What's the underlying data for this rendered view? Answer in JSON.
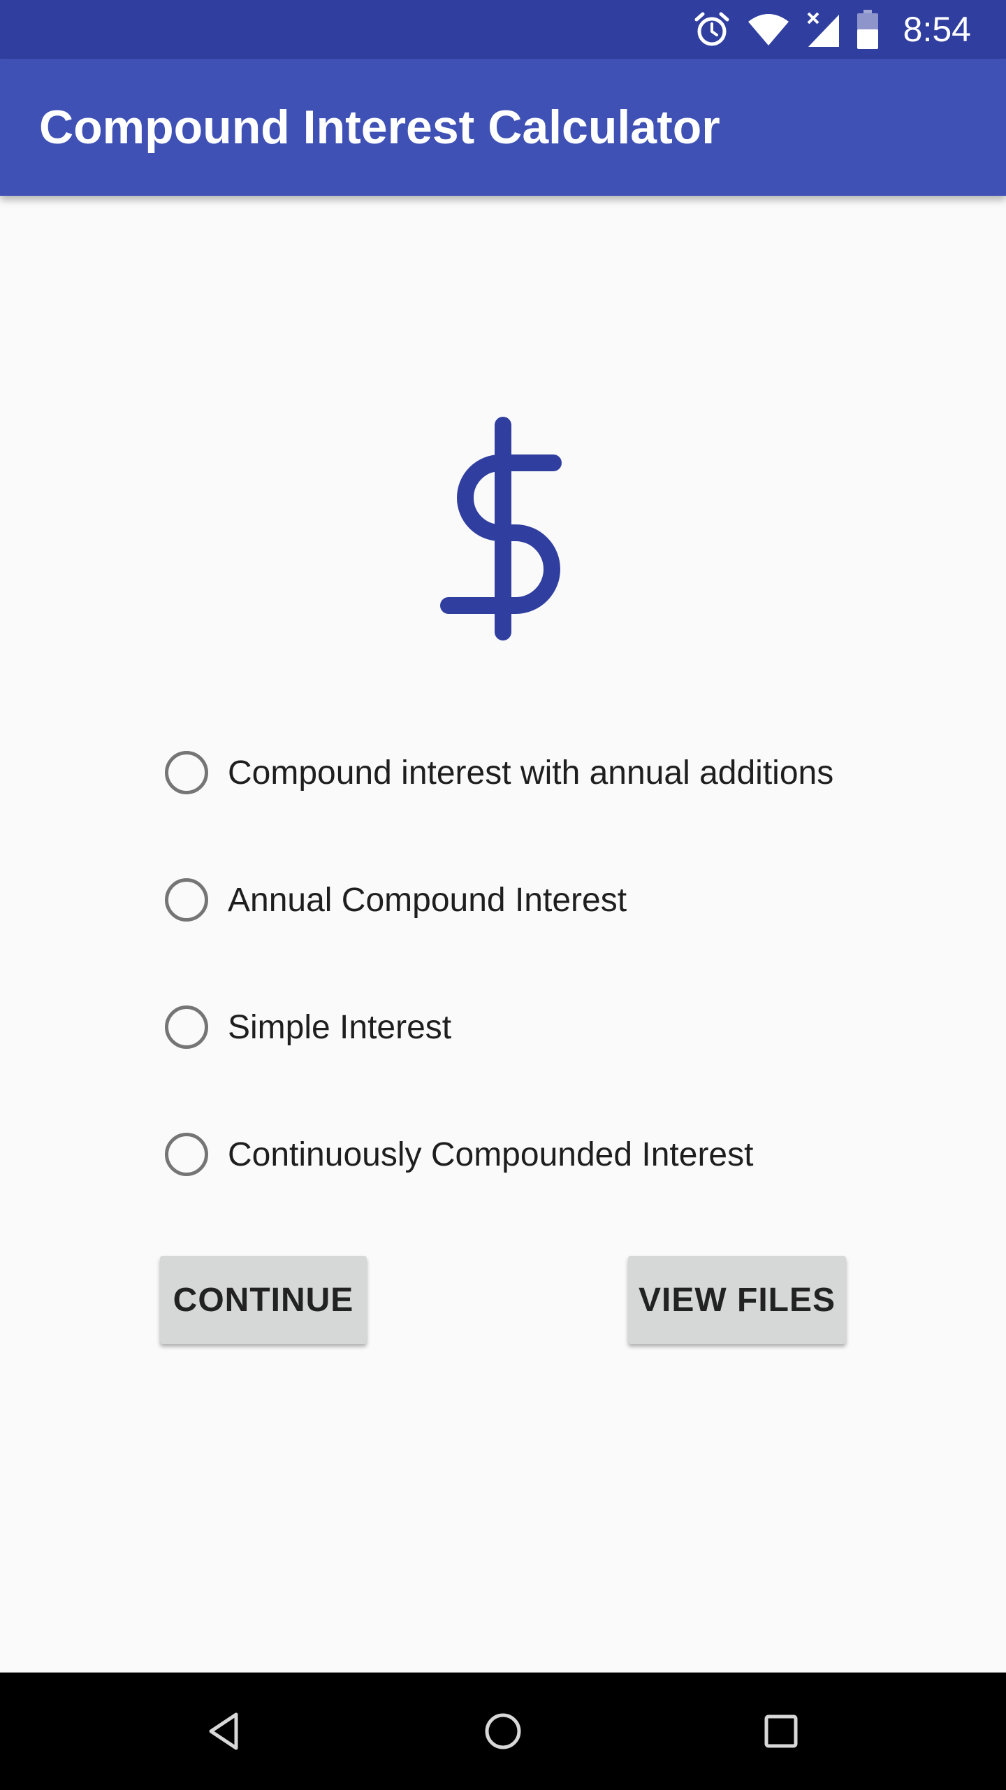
{
  "status_bar": {
    "time": "8:54",
    "icons": [
      "alarm-icon",
      "wifi-icon",
      "cell-signal-icon",
      "battery-icon"
    ],
    "color": "#303f9f"
  },
  "app_bar": {
    "title": "Compound Interest Calculator",
    "color": "#3f51b5"
  },
  "logo": {
    "icon": "dollar-icon",
    "color": "#303f9f"
  },
  "options": [
    {
      "label": "Compound interest with annual additions",
      "selected": false
    },
    {
      "label": "Annual Compound Interest",
      "selected": false
    },
    {
      "label": "Simple Interest",
      "selected": false
    },
    {
      "label": "Continuously Compounded Interest",
      "selected": false
    }
  ],
  "buttons": {
    "continue": "CONTINUE",
    "view_files": "VIEW FILES"
  },
  "nav_bar": {
    "icons": [
      "back-icon",
      "home-icon",
      "recents-icon"
    ]
  }
}
